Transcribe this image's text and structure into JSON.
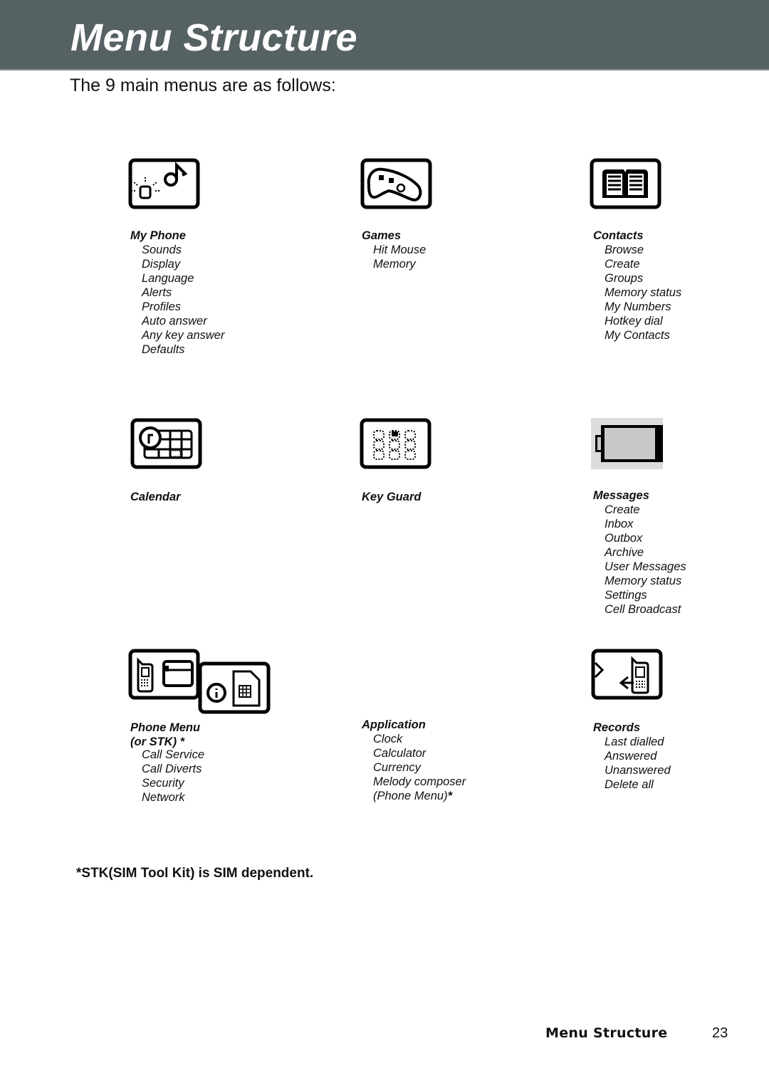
{
  "header": {
    "title": "Menu Structure"
  },
  "intro": "The 9 main menus are as follows:",
  "menus": [
    {
      "title": "My Phone",
      "icon": "bulb-and-music-note-icon",
      "items": [
        "Sounds",
        "Display",
        "Language",
        "Alerts",
        "Profiles",
        "Auto answer",
        "Any key answer",
        "Defaults"
      ]
    },
    {
      "title": "Games",
      "icon": "gamepad-icon",
      "items": [
        "Hit Mouse",
        "Memory"
      ]
    },
    {
      "title": "Contacts",
      "icon": "open-book-icon",
      "items": [
        "Browse",
        "Create",
        "Groups",
        "Memory status",
        "My Numbers",
        "Hotkey dial",
        "My Contacts"
      ]
    },
    {
      "title": "Calendar",
      "icon": "clock-calendar-icon",
      "items": []
    },
    {
      "title": "Key Guard",
      "icon": "keypad-lock-icon",
      "items": []
    },
    {
      "title": "Messages",
      "icon": "envelope-icon",
      "items": [
        "Create",
        "Inbox",
        "Outbox",
        "Archive",
        "User Messages",
        "Memory status",
        "Settings",
        "Cell Broadcast"
      ]
    },
    {
      "title": "Phone Menu",
      "title2": "(or STK)",
      "title2_mark": "*",
      "icon": "phone-sim-icon",
      "items": [
        "Call Service",
        "Call Diverts",
        "Security",
        "Network"
      ]
    },
    {
      "title": "Application",
      "icon": "",
      "items": [
        "Clock",
        "Calculator",
        "Currency",
        "Melody composer",
        "(Phone Menu)"
      ],
      "last_item_mark": "*"
    },
    {
      "title": "Records",
      "icon": "call-log-phone-icon",
      "items": [
        "Last dialled",
        "Answered",
        "Unanswered",
        "Delete all"
      ]
    }
  ],
  "footnote": "*STK(SIM Tool Kit) is SIM dependent.",
  "footer": {
    "section": "Menu Structure",
    "page": "23"
  }
}
